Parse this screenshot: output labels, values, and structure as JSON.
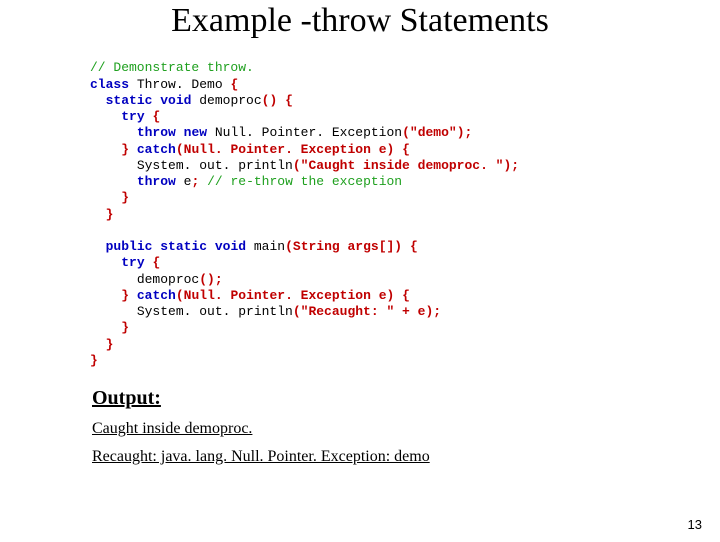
{
  "title": "Example -throw Statements",
  "code": {
    "c1": "// Demonstrate throw.",
    "k_class": "class",
    "cls": " Throw. Demo ",
    "k_static": "static",
    "k_void": "void",
    "m1": " demoproc",
    "paren_empty": "()",
    "k_try": "try",
    "k_throw": "throw",
    "k_new": "new",
    "npe": " Null. Pointer. Exception",
    "arg_demo": "(\"demo\")",
    "k_catch": "catch",
    "catch_arg": "(Null. Pointer. Exception e)",
    "s1a": "System. out. println",
    "s1b": "(\"Caught inside demoproc. \")",
    "rethrow": " e",
    "c2": "// re-throw the exception",
    "k_public": "public",
    "main_sig": " main",
    "main_args": "(String args[])",
    "call_demo": "demoproc",
    "s2b": "(\"Recaught: \" + e)",
    "ob": "{",
    "cb": "}",
    "sc": ";",
    "sp": " "
  },
  "output": {
    "label": "Output:",
    "line1": "Caught inside demoproc.",
    "line2": "Recaught: java. lang. Null. Pointer. Exception: demo"
  },
  "page": "13"
}
